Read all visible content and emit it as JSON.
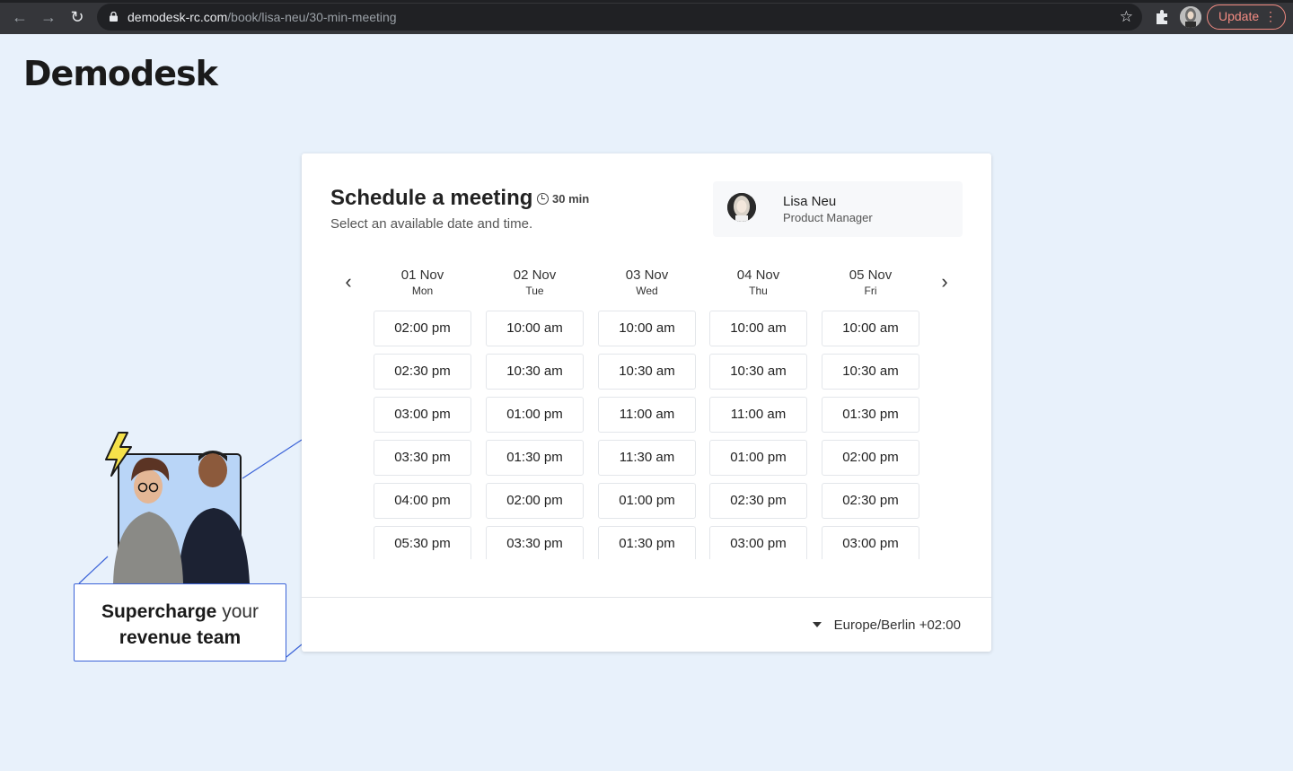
{
  "browser": {
    "url_host": "demodesk-rc.com",
    "url_path": "/book/lisa-neu/30-min-meeting",
    "update_label": "Update"
  },
  "brand": {
    "logo_text": "Demodesk"
  },
  "promo": {
    "bold1": "Supercharge",
    "light1": "your",
    "line2": "revenue team"
  },
  "booking": {
    "title": "Schedule a meeting",
    "duration": "30 min",
    "subtitle": "Select an available date and time.",
    "host": {
      "name": "Lisa Neu",
      "role": "Product Manager"
    },
    "days": [
      {
        "date": "01 Nov",
        "dow": "Mon",
        "slots": [
          "02:00 pm",
          "02:30 pm",
          "03:00 pm",
          "03:30 pm",
          "04:00 pm",
          "05:30 pm"
        ]
      },
      {
        "date": "02 Nov",
        "dow": "Tue",
        "slots": [
          "10:00 am",
          "10:30 am",
          "01:00 pm",
          "01:30 pm",
          "02:00 pm",
          "03:30 pm"
        ]
      },
      {
        "date": "03 Nov",
        "dow": "Wed",
        "slots": [
          "10:00 am",
          "10:30 am",
          "11:00 am",
          "11:30 am",
          "01:00 pm",
          "01:30 pm"
        ]
      },
      {
        "date": "04 Nov",
        "dow": "Thu",
        "slots": [
          "10:00 am",
          "10:30 am",
          "11:00 am",
          "01:00 pm",
          "02:30 pm",
          "03:00 pm"
        ]
      },
      {
        "date": "05 Nov",
        "dow": "Fri",
        "slots": [
          "10:00 am",
          "10:30 am",
          "01:30 pm",
          "02:00 pm",
          "02:30 pm",
          "03:00 pm"
        ]
      }
    ],
    "timezone": "Europe/Berlin +02:00"
  }
}
